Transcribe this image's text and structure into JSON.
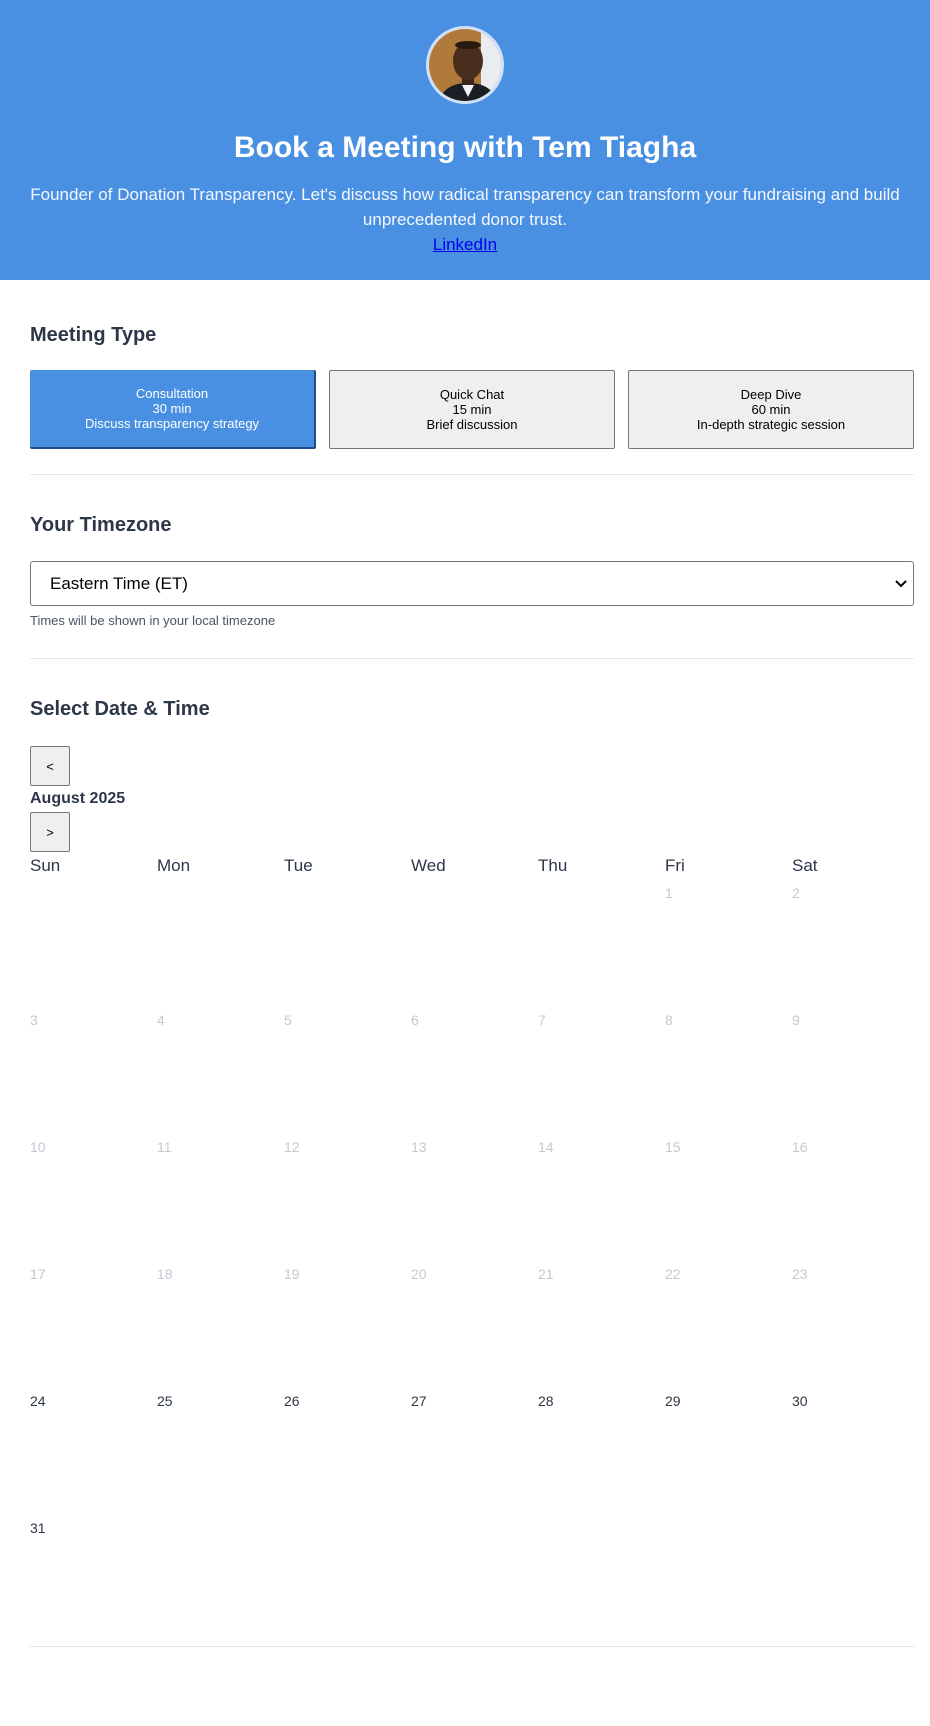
{
  "header": {
    "title": "Book a Meeting with Tem Tiagha",
    "description": "Founder of Donation Transparency. Let's discuss how radical transparency can transform your fundraising and build unprecedented donor trust.",
    "link_label": "LinkedIn",
    "brand_color": "#4a90e2"
  },
  "meeting_type": {
    "heading": "Meeting Type",
    "options": [
      {
        "name": "Consultation",
        "duration": "30 min",
        "desc": "Discuss transparency strategy",
        "selected": true
      },
      {
        "name": "Quick Chat",
        "duration": "15 min",
        "desc": "Brief discussion",
        "selected": false
      },
      {
        "name": "Deep Dive",
        "duration": "60 min",
        "desc": "In-depth strategic session",
        "selected": false
      }
    ]
  },
  "timezone": {
    "heading": "Your Timezone",
    "selected": "Eastern Time (ET)",
    "hint": "Times will be shown in your local timezone"
  },
  "calendar": {
    "heading": "Select Date & Time",
    "prev_label": "<",
    "next_label": ">",
    "month_label": "August 2025",
    "weekdays": [
      "Sun",
      "Mon",
      "Tue",
      "Wed",
      "Thu",
      "Fri",
      "Sat"
    ],
    "days": [
      {
        "day": "1",
        "available": false
      },
      {
        "day": "2",
        "available": false
      },
      {
        "day": "3",
        "available": false
      },
      {
        "day": "4",
        "available": false
      },
      {
        "day": "5",
        "available": false
      },
      {
        "day": "6",
        "available": false
      },
      {
        "day": "7",
        "available": false
      },
      {
        "day": "8",
        "available": false
      },
      {
        "day": "9",
        "available": false
      },
      {
        "day": "10",
        "available": false
      },
      {
        "day": "11",
        "available": false
      },
      {
        "day": "12",
        "available": false
      },
      {
        "day": "13",
        "available": false
      },
      {
        "day": "14",
        "available": false
      },
      {
        "day": "15",
        "available": false
      },
      {
        "day": "16",
        "available": false
      },
      {
        "day": "17",
        "available": false
      },
      {
        "day": "18",
        "available": false
      },
      {
        "day": "19",
        "available": false
      },
      {
        "day": "20",
        "available": false
      },
      {
        "day": "21",
        "available": false
      },
      {
        "day": "22",
        "available": false
      },
      {
        "day": "23",
        "available": false
      },
      {
        "day": "24",
        "available": true
      },
      {
        "day": "25",
        "available": true
      },
      {
        "day": "26",
        "available": true
      },
      {
        "day": "27",
        "available": true
      },
      {
        "day": "28",
        "available": true
      },
      {
        "day": "29",
        "available": true
      },
      {
        "day": "30",
        "available": true
      },
      {
        "day": "31",
        "available": true
      }
    ]
  }
}
